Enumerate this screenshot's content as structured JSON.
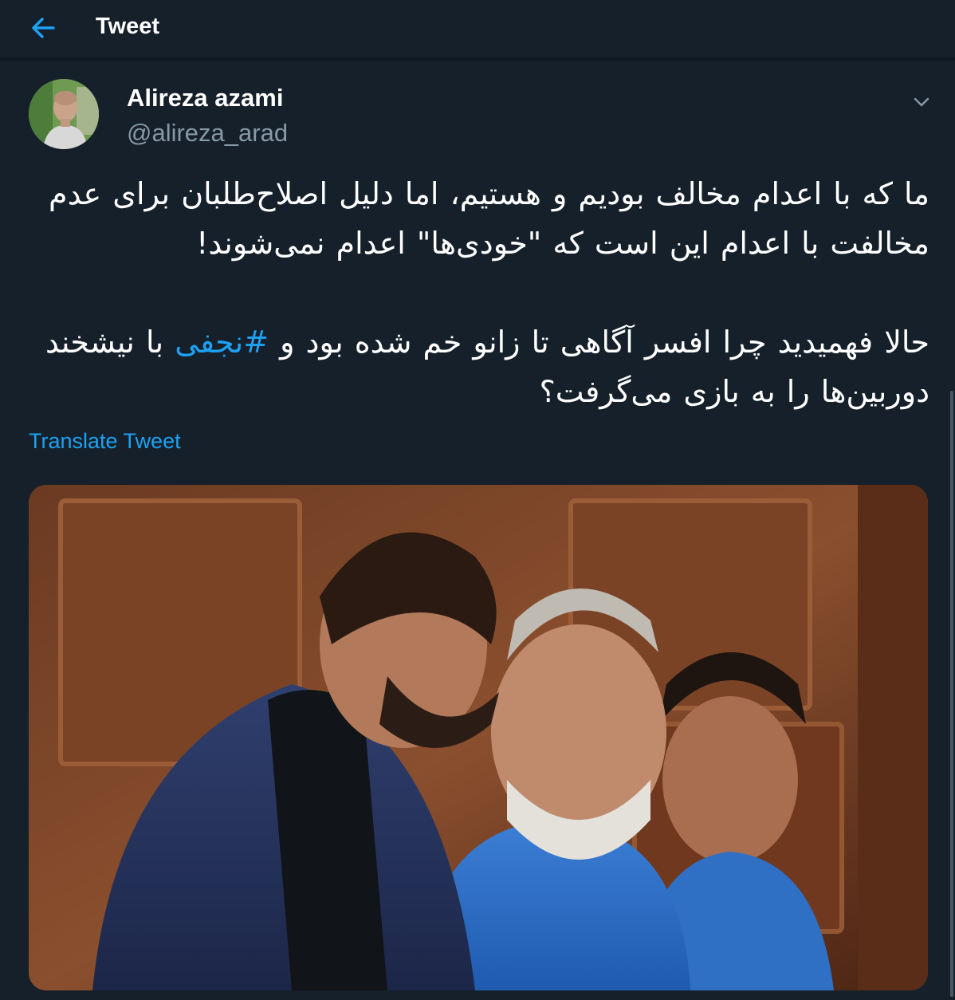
{
  "header": {
    "title": "Tweet",
    "back_icon": "arrow-left-icon"
  },
  "tweet": {
    "author": {
      "display_name": "Alireza azami",
      "handle": "@alireza_arad"
    },
    "menu_icon": "chevron-down-icon",
    "text": {
      "paragraph_1": "ما که با اعدام مخالف بودیم و هستیم، اما دلیل اصلاح‌طلبان برای عدم مخالفت با اعدام این است که \"خودی‌ها\" اعدام نمی‌شوند!",
      "paragraph_2_before": "حالا فهمیدید چرا افسر آگاهی تا زانو خم شده بود و ",
      "hashtag": "#نجفی",
      "paragraph_2_after": " با نیشخند دوربین‌ها را به بازی می‌گرفت؟"
    },
    "translate_label": "Translate Tweet"
  },
  "colors": {
    "background": "#15202b",
    "accent": "#1da1f2",
    "secondary_text": "#8899a6"
  }
}
